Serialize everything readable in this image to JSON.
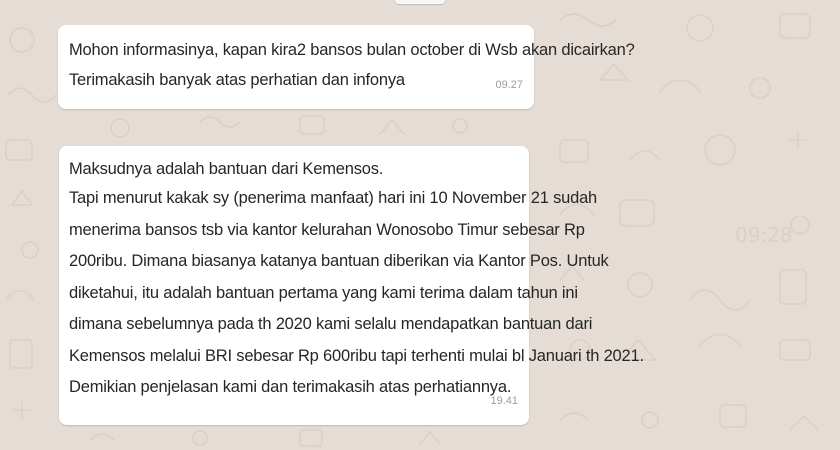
{
  "chat": {
    "wallpaper_color": "#e5ddd5",
    "messages": [
      {
        "lines": [
          "Mohon informasinya, kapan kira2 bansos bulan october di Wsb akan dicairkan?",
          "Terimakasih banyak atas perhatian dan infonya"
        ],
        "time": "09.27"
      },
      {
        "lines": [
          "Maksudnya adalah bantuan dari Kemensos.",
          "Tapi menurut kakak sy (penerima manfaat) hari ini 10 November 21 sudah",
          "menerima bansos tsb via kantor kelurahan Wonosobo Timur sebesar Rp",
          "200ribu. Dimana biasanya katanya bantuan diberikan via Kantor Pos. Untuk",
          "diketahui, itu adalah bantuan pertama yang kami terima dalam tahun ini",
          "dimana sebelumnya pada th 2020 kami selalu mendapatkan bantuan dari",
          "Kemensos melalui BRI sebesar Rp 600ribu tapi terhenti mulai bl Januari th 2021.",
          "Demikian penjelasan kami dan terimakasih atas perhatiannya."
        ],
        "time": "19.41"
      }
    ]
  }
}
